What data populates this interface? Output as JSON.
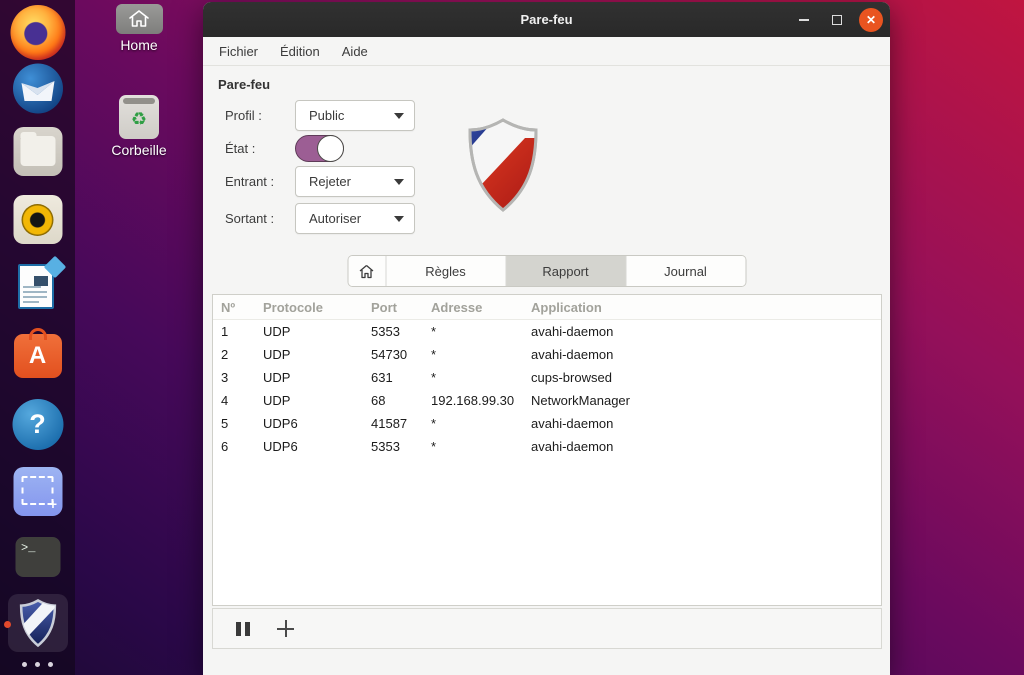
{
  "desktop": {
    "icons": [
      {
        "label": "Home"
      },
      {
        "label": "Corbeille",
        "glyph": "♻"
      }
    ]
  },
  "dock": {
    "items": [
      {
        "name": "firefox"
      },
      {
        "name": "thunderbird"
      },
      {
        "name": "files"
      },
      {
        "name": "rhythmbox"
      },
      {
        "name": "libreoffice-writer"
      },
      {
        "name": "ubuntu-software",
        "glyph": "A"
      },
      {
        "name": "help",
        "glyph": "?"
      },
      {
        "name": "screenshot-tool",
        "glyph": "+"
      },
      {
        "name": "terminal",
        "glyph": ">_"
      },
      {
        "name": "gufw-firewall",
        "running": true
      }
    ]
  },
  "window": {
    "title": "Pare-feu",
    "controls": {
      "close_glyph": "✕"
    },
    "menu": [
      "Fichier",
      "Édition",
      "Aide"
    ],
    "heading": "Pare-feu",
    "form": {
      "profil": {
        "label": "Profil :",
        "value": "Public"
      },
      "etat": {
        "label": "État :",
        "state": "on"
      },
      "entrant": {
        "label": "Entrant :",
        "value": "Rejeter"
      },
      "sortant": {
        "label": "Sortant :",
        "value": "Autoriser"
      }
    },
    "tabs": {
      "items": [
        {
          "label": "Règles",
          "selected": false
        },
        {
          "label": "Rapport",
          "selected": true
        },
        {
          "label": "Journal",
          "selected": false
        }
      ]
    },
    "table": {
      "columns": [
        "Nº",
        "Protocole",
        "Port",
        "Adresse",
        "Application"
      ],
      "rows": [
        [
          "1",
          "UDP",
          "5353",
          "*",
          "avahi-daemon"
        ],
        [
          "2",
          "UDP",
          "54730",
          "*",
          "avahi-daemon"
        ],
        [
          "3",
          "UDP",
          "631",
          "*",
          "cups-browsed"
        ],
        [
          "4",
          "UDP",
          "68",
          "192.168.99.30",
          "NetworkManager"
        ],
        [
          "5",
          "UDP6",
          "41587",
          "*",
          "avahi-daemon"
        ],
        [
          "6",
          "UDP6",
          "5353",
          "*",
          "avahi-daemon"
        ]
      ]
    },
    "colors": {
      "close_button": "#e95420",
      "toggle_on": "#9c5e94",
      "titlebar": "#2d2d2d",
      "tab_selected_bg": "#d4d4cf"
    }
  }
}
